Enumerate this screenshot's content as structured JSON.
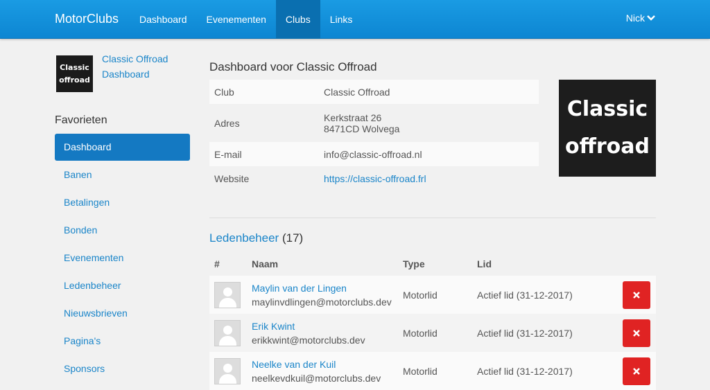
{
  "navbar": {
    "brand": "MotorClubs",
    "links": [
      "Dashboard",
      "Evenementen",
      "Clubs",
      "Links"
    ],
    "active_index": 2,
    "user": "Nick"
  },
  "sidebar": {
    "club_logo_text": [
      "Classic",
      "offroad"
    ],
    "club_name_link": "Classic Offroad",
    "dashboard_link": "Dashboard",
    "favorites_title": "Favorieten",
    "items": [
      "Dashboard",
      "Banen",
      "Betalingen",
      "Bonden",
      "Evenementen",
      "Ledenbeheer",
      "Nieuwsbrieven",
      "Pagina's",
      "Sponsors"
    ],
    "active_index": 0
  },
  "main": {
    "title": "Dashboard voor Classic Offroad",
    "info": {
      "club_label": "Club",
      "club_value": "Classic Offroad",
      "address_label": "Adres",
      "address_line1": "Kerkstraat 26",
      "address_line2": "8471CD Wolvega",
      "email_label": "E-mail",
      "email_value": "info@classic-offroad.nl",
      "website_label": "Website",
      "website_value": "https://classic-offroad.frl"
    },
    "logo_text": [
      "Classic",
      "offroad"
    ]
  },
  "members": {
    "title": "Ledenbeheer",
    "count": "(17)",
    "columns": [
      "#",
      "Naam",
      "Type",
      "Lid"
    ],
    "rows": [
      {
        "name": "Maylin van der Lingen",
        "email": "maylinvdlingen@motorclubs.dev",
        "type": "Motorlid",
        "lid": "Actief lid (31-12-2017)"
      },
      {
        "name": "Erik Kwint",
        "email": "erikkwint@motorclubs.dev",
        "type": "Motorlid",
        "lid": "Actief lid (31-12-2017)"
      },
      {
        "name": "Neelke van der Kuil",
        "email": "neelkevdkuil@motorclubs.dev",
        "type": "Motorlid",
        "lid": "Actief lid (31-12-2017)"
      }
    ]
  },
  "colors": {
    "navbar": "#1a9be3",
    "accent": "#1479c2",
    "link": "#1a85c9",
    "delete": "#e02323"
  }
}
